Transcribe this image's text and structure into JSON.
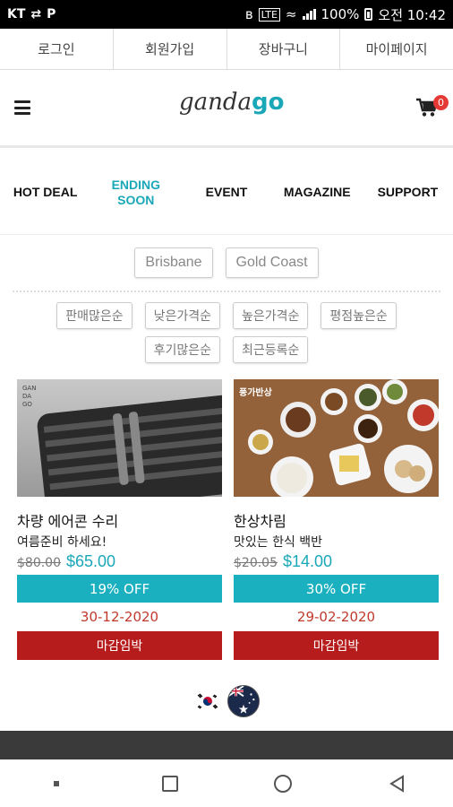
{
  "status_bar": {
    "carrier": "KT",
    "battery": "100%",
    "time": "오전 10:42"
  },
  "top_links": [
    "로그인",
    "회원가입",
    "장바구니",
    "마이페이지"
  ],
  "header": {
    "logo_part1": "ganda",
    "logo_part2": "go",
    "cart_count": "0"
  },
  "nav": [
    {
      "label": "HOT DEAL",
      "active": false
    },
    {
      "label": "ENDING SOON",
      "active": true
    },
    {
      "label": "EVENT",
      "active": false
    },
    {
      "label": "MAGAZINE",
      "active": false
    },
    {
      "label": "SUPPORT",
      "active": false
    }
  ],
  "locations": [
    "Brisbane",
    "Gold Coast"
  ],
  "sorts": [
    "판매많은순",
    "낮은가격순",
    "높은가격순",
    "평점높은순",
    "후기많은순",
    "최근등록순"
  ],
  "products": [
    {
      "image_text": "GAN DA GO",
      "title": "차량 에어콘 수리",
      "subtitle": "여름준비 하세요!",
      "old_price": "$80.00",
      "new_price": "$65.00",
      "discount": "19% OFF",
      "date": "30-12-2020",
      "deadline": "마감임박"
    },
    {
      "image_text": "풍가반상",
      "title": "한상차림",
      "subtitle": "맛있는 한식 백반",
      "old_price": "$20.05",
      "new_price": "$14.00",
      "discount": "30% OFF",
      "date": "29-02-2020",
      "deadline": "마감임박"
    }
  ],
  "colors": {
    "accent": "#1aa8b8",
    "discount_bar": "#1ab0c0",
    "deadline": "#b71c1c",
    "date_text": "#c0392b"
  }
}
